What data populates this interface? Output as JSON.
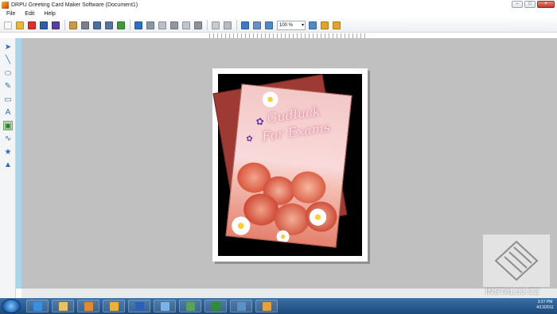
{
  "window": {
    "title": "DRPU Greeting Card Maker Software  (Document1)",
    "controls": [
      "–",
      "□",
      "×"
    ]
  },
  "menu": [
    "File",
    "Edit",
    "Help"
  ],
  "toolbar": {
    "zoom_value": "100 %",
    "buttons": [
      {
        "name": "new-icon",
        "color": "#f7f7f7"
      },
      {
        "name": "open-icon",
        "color": "#e9b83a"
      },
      {
        "name": "close-icon",
        "color": "#d9312b"
      },
      {
        "name": "save-icon",
        "color": "#2f5ea8"
      },
      {
        "name": "save-as-icon",
        "color": "#5b3fa0"
      },
      {
        "name": "properties-icon",
        "color": "#c89a43"
      },
      {
        "name": "print-icon",
        "color": "#7b8088"
      },
      {
        "name": "page-setup-icon",
        "color": "#4a6fa0"
      },
      {
        "name": "export-icon",
        "color": "#58769d"
      },
      {
        "name": "image-icon",
        "color": "#3e9b3a"
      },
      {
        "name": "undo-icon",
        "color": "#2f6fc3"
      },
      {
        "name": "redo-icon",
        "color": "#8a97a7"
      },
      {
        "name": "copy-icon",
        "color": "#b9c0c8"
      },
      {
        "name": "cut-icon",
        "color": "#9099a3"
      },
      {
        "name": "paste-icon",
        "color": "#bfc6cd"
      },
      {
        "name": "delete-icon",
        "color": "#8c939b"
      },
      {
        "name": "bring-front-icon",
        "color": "#c7ccd2"
      },
      {
        "name": "send-back-icon",
        "color": "#b5bcc4"
      },
      {
        "name": "grid-icon",
        "color": "#3e78c9"
      },
      {
        "name": "pattern-icon",
        "color": "#6a8fc8"
      },
      {
        "name": "zoom-in-icon",
        "color": "#4f89c7"
      },
      {
        "name": "zoom-out-icon",
        "color": "#4f89c7"
      },
      {
        "name": "lock-icon",
        "color": "#e2a52c"
      },
      {
        "name": "unlock-icon",
        "color": "#e2a52c"
      }
    ]
  },
  "left_tools": [
    "pointer-icon",
    "line-icon",
    "ellipse-icon",
    "pencil-icon",
    "rectangle-icon",
    "text-icon",
    "picture-icon",
    "curve-icon",
    "star-icon",
    "triangle-icon"
  ],
  "card": {
    "title_line1": "Gudluck",
    "title_line2": "For Exams"
  },
  "watermark": {
    "text": "INSTALUJ.CZ"
  },
  "taskbar": {
    "apps": [
      {
        "name": "ie-icon",
        "color": "#3b8fe0"
      },
      {
        "name": "explorer-icon",
        "color": "#e8c25a"
      },
      {
        "name": "media-player-icon",
        "color": "#e58a2a"
      },
      {
        "name": "outlook-icon",
        "color": "#f0b133"
      },
      {
        "name": "word-icon",
        "color": "#2b5fb8"
      },
      {
        "name": "paint-icon",
        "color": "#7cb3e6"
      },
      {
        "name": "greeting-card-app-icon",
        "color": "#5aa35a"
      },
      {
        "name": "excel-icon",
        "color": "#2f8a3a"
      },
      {
        "name": "pictures-icon",
        "color": "#5f8fc9"
      },
      {
        "name": "card-maker-icon",
        "color": "#e6a13a"
      }
    ],
    "clock_time": "3:27 PM",
    "clock_date": "4/13/2011"
  }
}
